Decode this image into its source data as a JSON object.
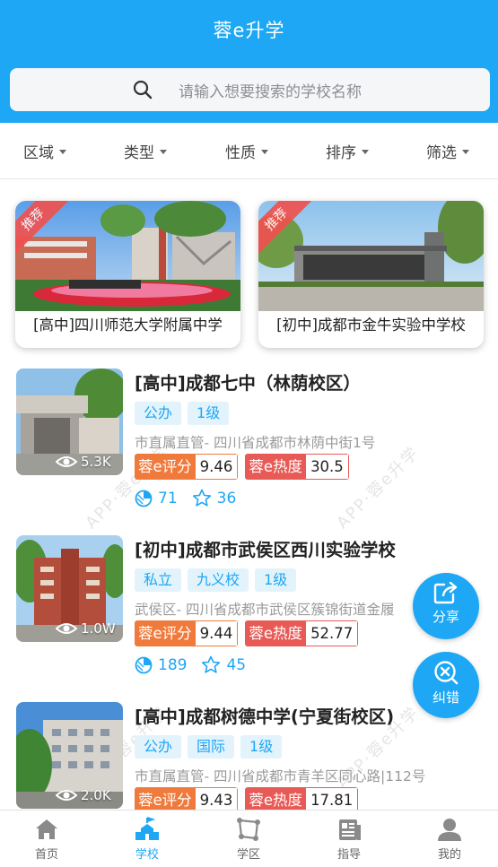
{
  "app": {
    "title": "蓉e升学"
  },
  "search": {
    "placeholder": "请输入想要搜索的学校名称"
  },
  "filters": [
    "区域",
    "类型",
    "性质",
    "排序",
    "筛选"
  ],
  "featured": [
    {
      "ribbon": "推荐",
      "caption": "[高中]四川师范大学附属中学"
    },
    {
      "ribbon": "推荐",
      "caption": "[初中]成都市金牛实验中学校"
    }
  ],
  "schools": [
    {
      "name": "[高中]成都七中（林荫校区）",
      "views": "5.3K",
      "tags": [
        "公办",
        "1级"
      ],
      "address": "市直属直管- 四川省成都市林荫中街1号",
      "score_label": "蓉e评分",
      "score": "9.46",
      "heat_label": "蓉e热度",
      "heat": "30.5",
      "stat1": "71",
      "stat2": "36"
    },
    {
      "name": "[初中]成都市武侯区西川实验学校",
      "views": "1.0W",
      "tags": [
        "私立",
        "九义校",
        "1级"
      ],
      "address": "武侯区- 四川省成都市武侯区簇锦街道金履",
      "score_label": "蓉e评分",
      "score": "9.44",
      "heat_label": "蓉e热度",
      "heat": "52.77",
      "stat1": "189",
      "stat2": "45"
    },
    {
      "name": "[高中]成都树德中学(宁夏街校区)",
      "views": "2.0K",
      "tags": [
        "公办",
        "国际",
        "1级"
      ],
      "address": "市直属直管- 四川省成都市青羊区同心路|112号",
      "score_label": "蓉e评分",
      "score": "9.43",
      "heat_label": "蓉e热度",
      "heat": "17.81"
    }
  ],
  "watermark": "APP·蓉e升学",
  "fab": {
    "share": "分享",
    "correct": "纠错"
  },
  "tabs": [
    "首页",
    "学校",
    "学区",
    "指导",
    "我的"
  ],
  "colors": {
    "primary": "#1da7f4",
    "score": "#f07a3b",
    "heat": "#e85a56",
    "ribbon": "#f0514f"
  }
}
